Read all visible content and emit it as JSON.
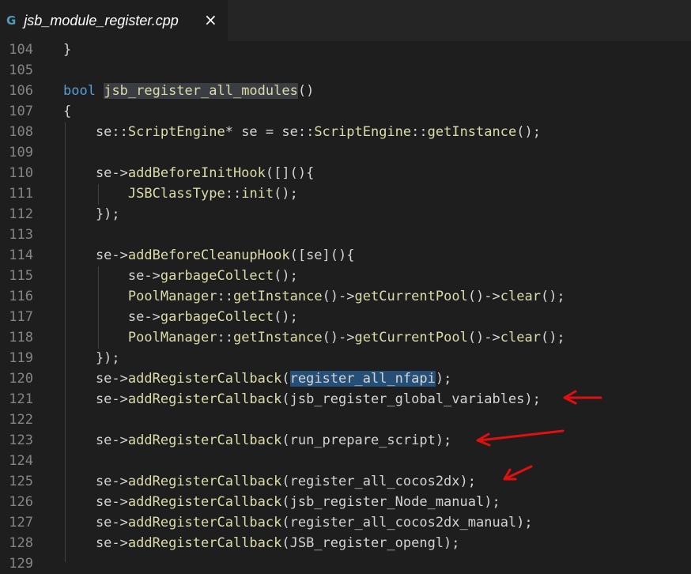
{
  "tab": {
    "icon": "cpp-file-icon",
    "icon_glyph": "G",
    "title": "jsb_module_register.cpp",
    "close": "×"
  },
  "code_lines": [
    {
      "num": "104",
      "tokens": [
        {
          "t": "}"
        }
      ]
    },
    {
      "num": "105",
      "tokens": []
    },
    {
      "num": "106",
      "tokens": [
        {
          "t": "bool",
          "c": "kw"
        },
        {
          "t": " "
        },
        {
          "t": "jsb_register_all_modules",
          "c": "fn hl"
        },
        {
          "t": "()"
        }
      ]
    },
    {
      "num": "107",
      "tokens": [
        {
          "t": "{"
        }
      ]
    },
    {
      "num": "108",
      "tokens": [
        {
          "t": "    se::"
        },
        {
          "t": "ScriptEngine",
          "c": "fn"
        },
        {
          "t": "* se = se::"
        },
        {
          "t": "ScriptEngine",
          "c": "fn"
        },
        {
          "t": "::"
        },
        {
          "t": "getInstance",
          "c": "fn"
        },
        {
          "t": "();"
        }
      ]
    },
    {
      "num": "109",
      "tokens": []
    },
    {
      "num": "110",
      "tokens": [
        {
          "t": "    se->"
        },
        {
          "t": "addBeforeInitHook",
          "c": "fn"
        },
        {
          "t": "([](){"
        }
      ]
    },
    {
      "num": "111",
      "tokens": [
        {
          "t": "        "
        },
        {
          "t": "JSBClassType",
          "c": "fn"
        },
        {
          "t": "::"
        },
        {
          "t": "init",
          "c": "fn"
        },
        {
          "t": "();"
        }
      ]
    },
    {
      "num": "112",
      "tokens": [
        {
          "t": "    });"
        }
      ]
    },
    {
      "num": "113",
      "tokens": []
    },
    {
      "num": "114",
      "tokens": [
        {
          "t": "    se->"
        },
        {
          "t": "addBeforeCleanupHook",
          "c": "fn"
        },
        {
          "t": "([se](){"
        }
      ]
    },
    {
      "num": "115",
      "tokens": [
        {
          "t": "        se->"
        },
        {
          "t": "garbageCollect",
          "c": "fn"
        },
        {
          "t": "();"
        }
      ]
    },
    {
      "num": "116",
      "tokens": [
        {
          "t": "        "
        },
        {
          "t": "PoolManager",
          "c": "fn"
        },
        {
          "t": "::"
        },
        {
          "t": "getInstance",
          "c": "fn"
        },
        {
          "t": "()->"
        },
        {
          "t": "getCurrentPool",
          "c": "fn"
        },
        {
          "t": "()->"
        },
        {
          "t": "clear",
          "c": "fn"
        },
        {
          "t": "();"
        }
      ]
    },
    {
      "num": "117",
      "tokens": [
        {
          "t": "        se->"
        },
        {
          "t": "garbageCollect",
          "c": "fn"
        },
        {
          "t": "();"
        }
      ]
    },
    {
      "num": "118",
      "tokens": [
        {
          "t": "        "
        },
        {
          "t": "PoolManager",
          "c": "fn"
        },
        {
          "t": "::"
        },
        {
          "t": "getInstance",
          "c": "fn"
        },
        {
          "t": "()->"
        },
        {
          "t": "getCurrentPool",
          "c": "fn"
        },
        {
          "t": "()->"
        },
        {
          "t": "clear",
          "c": "fn"
        },
        {
          "t": "();"
        }
      ]
    },
    {
      "num": "119",
      "tokens": [
        {
          "t": "    });"
        }
      ]
    },
    {
      "num": "120",
      "tokens": [
        {
          "t": "    se->"
        },
        {
          "t": "addRegisterCallback",
          "c": "fn"
        },
        {
          "t": "("
        },
        {
          "t": "register_all_nfapi",
          "c": "sel"
        },
        {
          "t": ");"
        }
      ]
    },
    {
      "num": "121",
      "tokens": [
        {
          "t": "    se->"
        },
        {
          "t": "addRegisterCallback",
          "c": "fn"
        },
        {
          "t": "(jsb_register_global_variables);"
        }
      ]
    },
    {
      "num": "122",
      "tokens": []
    },
    {
      "num": "123",
      "tokens": [
        {
          "t": "    se->"
        },
        {
          "t": "addRegisterCallback",
          "c": "fn"
        },
        {
          "t": "(run_prepare_script);"
        }
      ]
    },
    {
      "num": "124",
      "tokens": []
    },
    {
      "num": "125",
      "tokens": [
        {
          "t": "    se->"
        },
        {
          "t": "addRegisterCallback",
          "c": "fn"
        },
        {
          "t": "(register_all_cocos2dx);"
        }
      ]
    },
    {
      "num": "126",
      "tokens": [
        {
          "t": "    se->"
        },
        {
          "t": "addRegisterCallback",
          "c": "fn"
        },
        {
          "t": "(jsb_register_Node_manual);"
        }
      ]
    },
    {
      "num": "127",
      "tokens": [
        {
          "t": "    se->"
        },
        {
          "t": "addRegisterCallback",
          "c": "fn"
        },
        {
          "t": "(register_all_cocos2dx_manual);"
        }
      ]
    },
    {
      "num": "128",
      "tokens": [
        {
          "t": "    se->"
        },
        {
          "t": "addRegisterCallback",
          "c": "fn"
        },
        {
          "t": "(JSB_register_opengl);"
        }
      ]
    },
    {
      "num": "129",
      "tokens": []
    }
  ],
  "annotations": {
    "arrow_color": "#e01010",
    "arrow_lines": [
      "121",
      "123",
      "125"
    ]
  }
}
